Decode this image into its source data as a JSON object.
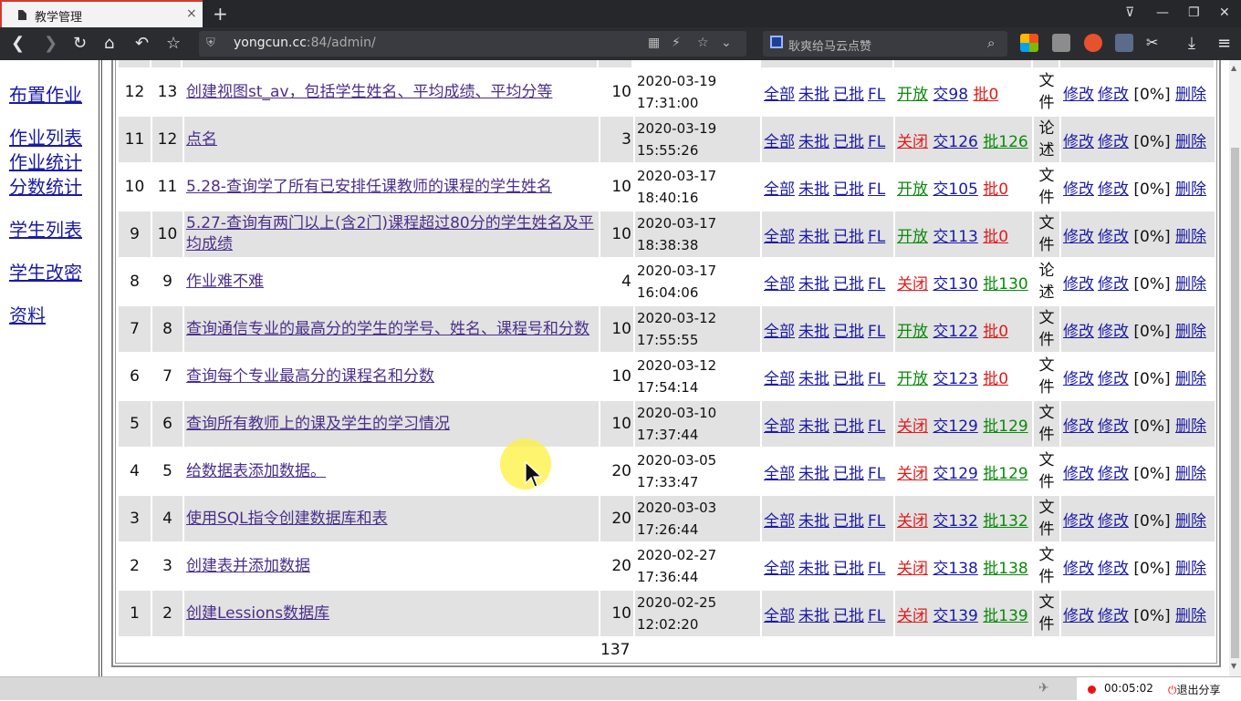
{
  "browser": {
    "tab_title": "教学管理",
    "tab_close": "×",
    "new_tab": "+",
    "url_host": "yongcun.cc",
    "url_rest": ":84/admin/",
    "search_placeholder": "耿爽给马云点赞",
    "window_controls": [
      "⊽",
      "—",
      "❐",
      "✕"
    ]
  },
  "sidebar": {
    "items": [
      "布置作业",
      "作业列表",
      "作业统计",
      "分数统计",
      "学生列表",
      "学生改密",
      "资料"
    ]
  },
  "table": {
    "op_labels": [
      "全部",
      "未批",
      "已批",
      "FL"
    ],
    "action_labels": [
      "修改",
      "修改",
      "删除"
    ],
    "rows": [
      {
        "a": "12",
        "b": "13",
        "title": "创建视图st_av，包括学生姓名、平均成绩、平均分等",
        "score": "10",
        "date": "2020-03-19",
        "time": "17:31:00",
        "state": "开放",
        "submitted": "交98",
        "graded": "批0",
        "kind1": "文",
        "kind2": "件",
        "pct": "[0%]"
      },
      {
        "a": "11",
        "b": "12",
        "title": "点名",
        "score": "3",
        "date": "2020-03-19",
        "time": "15:55:26",
        "state": "关闭",
        "submitted": "交126",
        "graded": "批126",
        "kind1": "论",
        "kind2": "述",
        "pct": "[0%]"
      },
      {
        "a": "10",
        "b": "11",
        "title": "5.28-查询学了所有已安排任课教师的课程的学生姓名",
        "score": "10",
        "date": "2020-03-17",
        "time": "18:40:16",
        "state": "开放",
        "submitted": "交105",
        "graded": "批0",
        "kind1": "文",
        "kind2": "件",
        "pct": "[0%]"
      },
      {
        "a": "9",
        "b": "10",
        "title": "5.27-查询有两门以上(含2门)课程超过80分的学生姓名及平均成绩",
        "score": "10",
        "date": "2020-03-17",
        "time": "18:38:38",
        "state": "开放",
        "submitted": "交113",
        "graded": "批0",
        "kind1": "文",
        "kind2": "件",
        "pct": "[0%]"
      },
      {
        "a": "8",
        "b": "9",
        "title": "作业难不难",
        "score": "4",
        "date": "2020-03-17",
        "time": "16:04:06",
        "state": "关闭",
        "submitted": "交130",
        "graded": "批130",
        "kind1": "论",
        "kind2": "述",
        "pct": "[0%]"
      },
      {
        "a": "7",
        "b": "8",
        "title": "查询通信专业的最高分的学生的学号、姓名、课程号和分数",
        "score": "10",
        "date": "2020-03-12",
        "time": "17:55:55",
        "state": "开放",
        "submitted": "交122",
        "graded": "批0",
        "kind1": "文",
        "kind2": "件",
        "pct": "[0%]"
      },
      {
        "a": "6",
        "b": "7",
        "title": "查询每个专业最高分的课程名和分数",
        "score": "10",
        "date": "2020-03-12",
        "time": "17:54:14",
        "state": "开放",
        "submitted": "交123",
        "graded": "批0",
        "kind1": "文",
        "kind2": "件",
        "pct": "[0%]"
      },
      {
        "a": "5",
        "b": "6",
        "title": "查询所有教师上的课及学生的学习情况",
        "score": "10",
        "date": "2020-03-10",
        "time": "17:37:44",
        "state": "关闭",
        "submitted": "交129",
        "graded": "批129",
        "kind1": "文",
        "kind2": "件",
        "pct": "[0%]"
      },
      {
        "a": "4",
        "b": "5",
        "title": "给数据表添加数据。",
        "score": "20",
        "date": "2020-03-05",
        "time": "17:33:47",
        "state": "关闭",
        "submitted": "交129",
        "graded": "批129",
        "kind1": "文",
        "kind2": "件",
        "pct": "[0%]"
      },
      {
        "a": "3",
        "b": "4",
        "title": "使用SQL指令创建数据库和表",
        "score": "20",
        "date": "2020-03-03",
        "time": "17:26:44",
        "state": "关闭",
        "submitted": "交132",
        "graded": "批132",
        "kind1": "文",
        "kind2": "件",
        "pct": "[0%]"
      },
      {
        "a": "2",
        "b": "3",
        "title": "创建表并添加数据",
        "score": "20",
        "date": "2020-02-27",
        "time": "17:36:44",
        "state": "关闭",
        "submitted": "交138",
        "graded": "批138",
        "kind1": "文",
        "kind2": "件",
        "pct": "[0%]"
      },
      {
        "a": "1",
        "b": "2",
        "title": "创建Lessions数据库",
        "score": "10",
        "date": "2020-02-25",
        "time": "12:02:20",
        "state": "关闭",
        "submitted": "交139",
        "graded": "批139",
        "kind1": "文",
        "kind2": "件",
        "pct": "[0%]"
      }
    ],
    "total": "137"
  },
  "recorder": {
    "time": "00:05:02",
    "exit_label": "退出分享"
  },
  "colors": {
    "open": "#0a8a0a",
    "closed": "#e21a1a",
    "link": "#1a1aa6",
    "row_alt": "#e2e2e2"
  }
}
